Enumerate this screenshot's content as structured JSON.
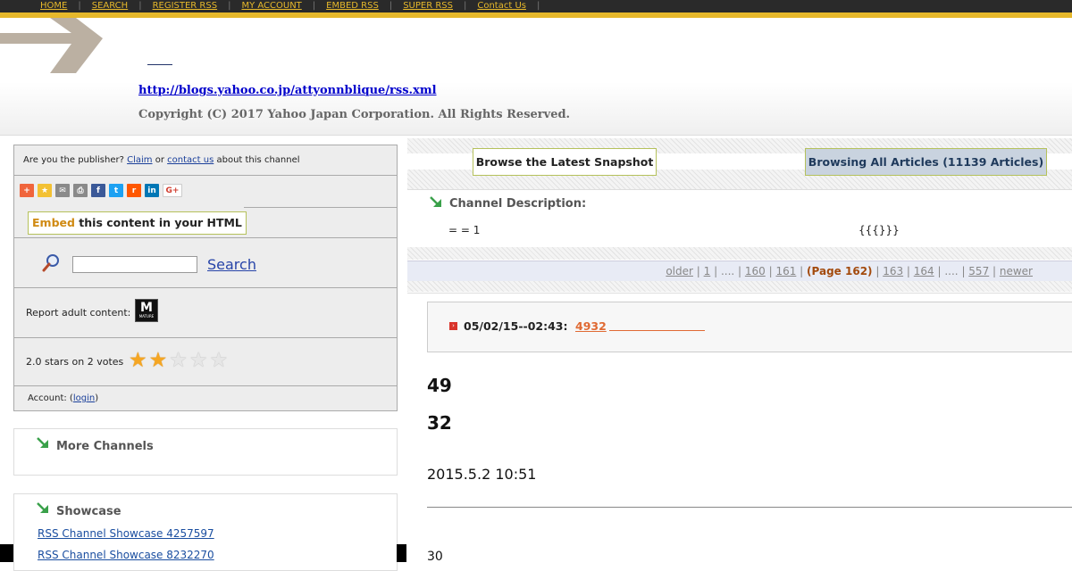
{
  "nav": {
    "items": [
      "HOME",
      "SEARCH",
      "REGISTER RSS",
      "MY ACCOUNT",
      "EMBED RSS",
      "SUPER RSS",
      "Contact Us"
    ],
    "separator": "|",
    "accent": "#e6b82b"
  },
  "header": {
    "feed_url": "http://blogs.yahoo.co.jp/attyonnblique/rss.xml",
    "copyright": "Copyright (C) 2017 Yahoo Japan Corporation. All Rights Reserved."
  },
  "sidebar": {
    "publisher": {
      "prefix": "Are you the publisher?",
      "claim": "Claim",
      "or": "or",
      "contact": "contact us",
      "suffix": "about this channel"
    },
    "share_icons": [
      {
        "icon": "plus-icon",
        "glyph": "+",
        "color": "#f0653c"
      },
      {
        "icon": "star-icon",
        "glyph": "★",
        "color": "#f3c133"
      },
      {
        "icon": "mail-icon",
        "glyph": "✉",
        "color": "#8a8a8a"
      },
      {
        "icon": "print-icon",
        "glyph": "⎙",
        "color": "#8a8a8a"
      },
      {
        "icon": "facebook-icon",
        "glyph": "f",
        "color": "#3b5998"
      },
      {
        "icon": "twitter-icon",
        "glyph": "t",
        "color": "#1da1f2"
      },
      {
        "icon": "reddit-icon",
        "glyph": "r",
        "color": "#ff5700"
      },
      {
        "icon": "linkedin-icon",
        "glyph": "in",
        "color": "#0077b5"
      },
      {
        "icon": "google-plus-icon",
        "glyph": "G+",
        "color": "#ffffff"
      }
    ],
    "embed": {
      "word": "Embed",
      "rest": " this content in your HTML"
    },
    "search": {
      "label": "Search",
      "value": ""
    },
    "adult": {
      "label": "Report adult content:",
      "badge": "M",
      "badge_small": "MATURE"
    },
    "rating": {
      "label": "2.0 stars on 2 votes",
      "stars": 2,
      "max": 5
    },
    "account": {
      "prefix": "Account: (",
      "login": "login",
      "suffix": ")"
    },
    "more_channels": "More Channels",
    "showcase": {
      "title": "Showcase",
      "links": [
        "RSS Channel Showcase 4257597",
        "RSS Channel Showcase 8232270"
      ]
    }
  },
  "main": {
    "snapshot_button": "Browse the Latest Snapshot",
    "browsing_button": "Browsing All Articles (11139 Articles)",
    "description": {
      "title": "Channel Description:",
      "left": "= = 1",
      "right": "{{{}}}"
    },
    "pager": {
      "older": "older",
      "p1": "1",
      "ellipsis": "....",
      "p160": "160",
      "p161": "161",
      "current": "(Page 162)",
      "p163": "163",
      "p164": "164",
      "p557": "557",
      "newer": "newer"
    },
    "article": {
      "date": "05/02/15--02:43:",
      "link": "4932",
      "big1": "49",
      "big2": "32",
      "stamp": "2015.5.2 10:51",
      "tail": "30"
    }
  }
}
